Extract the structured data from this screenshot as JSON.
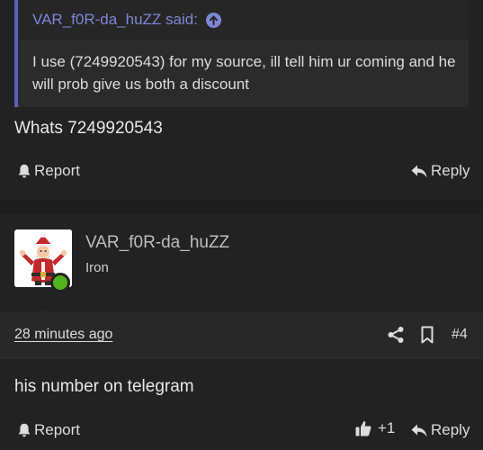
{
  "post1": {
    "quote_author": "VAR_f0R-da_huZZ said:",
    "quote_text": "I use (7249920543) for my source, ill tell him ur coming and he will prob give us both a discount",
    "message": "Whats 7249920543",
    "report_label": "Report",
    "reply_label": "Reply"
  },
  "post2": {
    "username": "VAR_f0R-da_huZZ",
    "rank": "Iron",
    "timestamp": "28 minutes ago",
    "post_number": "#4",
    "message": "his number on telegram",
    "report_label": "Report",
    "like_count": "+1",
    "reply_label": "Reply"
  },
  "icons": {
    "quote_link": "arrow-up-circle-icon",
    "report": "bell-icon",
    "reply": "reply-arrow-icon",
    "share": "share-icon",
    "bookmark": "bookmark-icon",
    "like": "thumbs-up-icon"
  },
  "colors": {
    "background": "#1d1d1d",
    "post_background": "#222222",
    "quote_accent": "#5b61b8",
    "quote_author": "#7e86d6",
    "online_status": "#55b31c"
  }
}
